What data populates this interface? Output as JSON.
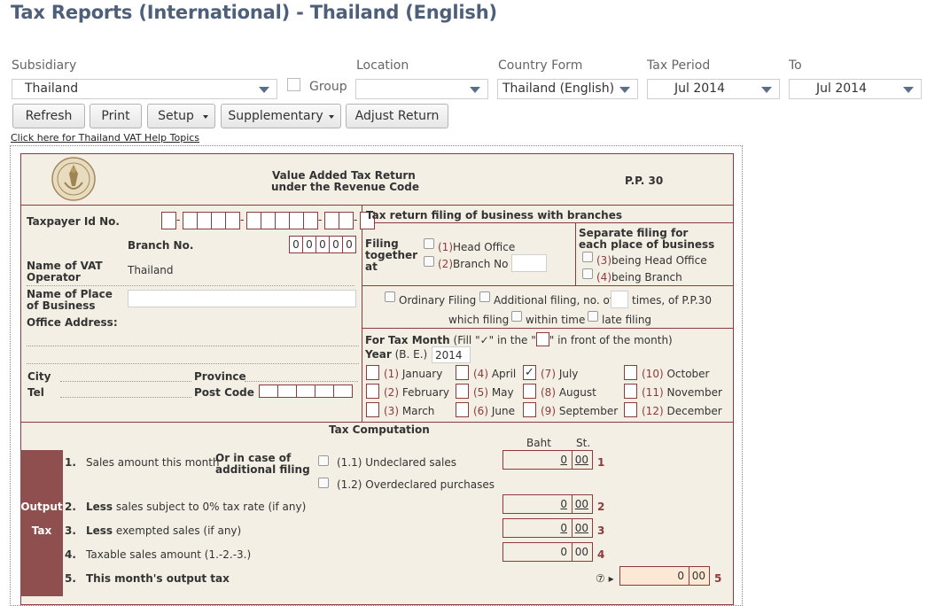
{
  "page_title": "Tax Reports (International) - Thailand (English)",
  "filters": {
    "subsidiary": {
      "label": "Subsidiary",
      "value": "Thailand"
    },
    "group": {
      "label": "Group"
    },
    "location": {
      "label": "Location",
      "value": ""
    },
    "country_form": {
      "label": "Country Form",
      "value": "Thailand (English)"
    },
    "tax_period": {
      "label": "Tax Period",
      "value": "Jul 2014"
    },
    "to": {
      "label": "To",
      "value": "Jul 2014"
    }
  },
  "toolbar": {
    "refresh": "Refresh",
    "print": "Print",
    "setup": "Setup",
    "supplementary": "Supplementary",
    "adjust_return": "Adjust Return"
  },
  "help_link": "Click here for Thailand VAT Help Topics",
  "form": {
    "title_line1": "Value Added Tax Return",
    "title_line2": "under the Revenue Code",
    "form_code": "P.P. 30",
    "taxpayer_id_label": "Taxpayer Id No.",
    "branch_no_label": "Branch No.",
    "branch_digits": [
      "0",
      "0",
      "0",
      "0",
      "0"
    ],
    "vat_operator_label_1": "Name of VAT",
    "vat_operator_label_2": "Operator",
    "vat_operator_value": "Thailand",
    "place_label_1": "Name of Place",
    "place_label_2": "of Business",
    "office_address_label": "Office Address:",
    "city_label": "City",
    "province_label": "Province",
    "tel_label": "Tel",
    "post_code_label": "Post Code",
    "branches_header": "Tax return filing of business with branches",
    "filing_together_1": "Filing",
    "filing_together_2": "together",
    "filing_together_3": "at",
    "opt1_num": "(1)",
    "opt1_text": "Head Office",
    "opt2_num": "(2)",
    "opt2_text": "Branch No",
    "separate_1": "Separate filing for",
    "separate_2": "each place of business",
    "opt3_num": "(3)",
    "opt3_text": "being Head Office",
    "opt4_num": "(4)",
    "opt4_text": "being Branch",
    "ordinary_filing": "Ordinary Filing",
    "additional_filing": "Additional filing, no. of",
    "times_of": "times, of P.P.30",
    "which_filing": "which filing",
    "within_time": "within time",
    "late_filing": "late filing",
    "tax_month_label": "For Tax Month",
    "tax_month_fill_1": "(Fill \"✓\" in the \"",
    "tax_month_fill_2": "\" in front of the month)",
    "year_label": "Year",
    "year_be": "(B. E.)",
    "year_value": "2014",
    "months": [
      {
        "num": "(1)",
        "name": "January",
        "checked": ""
      },
      {
        "num": "(2)",
        "name": "February",
        "checked": ""
      },
      {
        "num": "(3)",
        "name": "March",
        "checked": ""
      },
      {
        "num": "(4)",
        "name": "April",
        "checked": ""
      },
      {
        "num": "(5)",
        "name": "May",
        "checked": ""
      },
      {
        "num": "(6)",
        "name": "June",
        "checked": ""
      },
      {
        "num": "(7)",
        "name": "July",
        "checked": "✓"
      },
      {
        "num": "(8)",
        "name": "August",
        "checked": ""
      },
      {
        "num": "(9)",
        "name": "September",
        "checked": ""
      },
      {
        "num": "(10)",
        "name": "October",
        "checked": ""
      },
      {
        "num": "(11)",
        "name": "November",
        "checked": ""
      },
      {
        "num": "(12)",
        "name": "December",
        "checked": ""
      }
    ],
    "tax_computation": "Tax Computation",
    "baht": "Baht",
    "st": "St.",
    "sidebar_output": "Output",
    "sidebar_tax": "Tax",
    "rows": [
      {
        "num": "1.",
        "bold": "",
        "text": "Sales amount this month",
        "baht": "0",
        "st": "00",
        "line": "1"
      },
      {
        "num": "2.",
        "bold": "Less",
        "text": "sales subject to 0% tax rate (if any)",
        "baht": "0",
        "st": "00",
        "line": "2"
      },
      {
        "num": "3.",
        "bold": "Less",
        "text": "exempted sales (if any)",
        "baht": "0",
        "st": "00",
        "line": "3"
      },
      {
        "num": "4.",
        "bold": "",
        "text": "Taxable sales amount (1.-2.-3.)",
        "baht": "0",
        "st": "00",
        "line": "4"
      },
      {
        "num": "5.",
        "bold": "This month's output tax",
        "text": "",
        "baht": "0",
        "st": "00",
        "line": "5"
      }
    ],
    "additional_case_1": "Or in case of",
    "additional_case_2": "additional filing",
    "undeclared": "(1.1) Undeclared sales",
    "overdeclared": "(1.2) Overdeclared purchases",
    "row5_marker": "⑦ ▸"
  }
}
